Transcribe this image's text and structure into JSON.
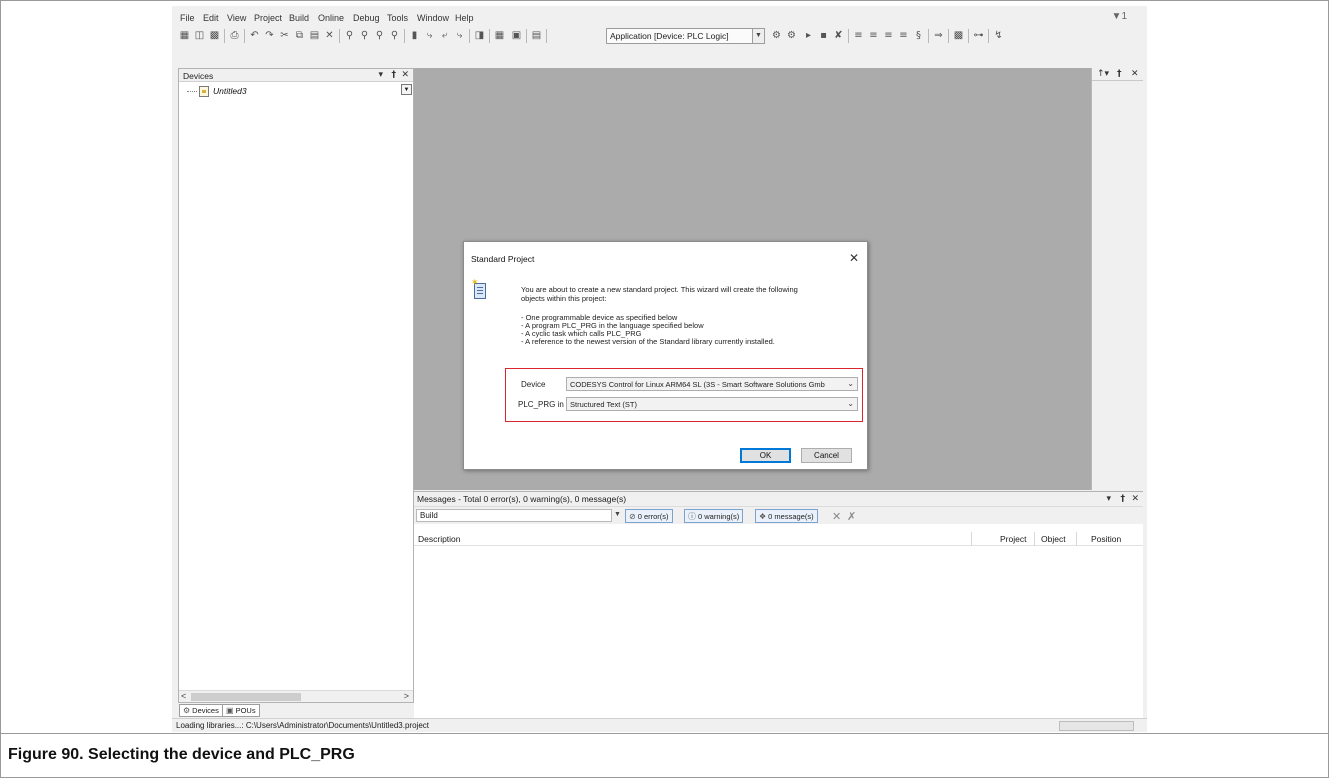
{
  "menu": [
    "File",
    "Edit",
    "View",
    "Project",
    "Build",
    "Online",
    "Debug",
    "Tools",
    "Window",
    "Help"
  ],
  "filter_indicator": "1",
  "toolbar": {
    "application_combo": "Application [Device: PLC Logic]"
  },
  "devices_panel": {
    "title": "Devices",
    "tree_item": "Untitled3",
    "tabs": [
      "Devices",
      "POUs"
    ]
  },
  "dialog": {
    "title": "Standard Project",
    "intro_line1": "You are about to create a new standard project. This wizard will create the following",
    "intro_line2": "objects within this project:",
    "bullets": [
      "- One programmable device as specified below",
      "- A program PLC_PRG in the language specified below",
      "- A cyclic task which calls PLC_PRG",
      "- A reference to the newest version of the Standard library currently installed."
    ],
    "device_label": "Device",
    "device_value": "CODESYS Control for Linux ARM64 SL (3S - Smart Software Solutions Gmb",
    "plcprg_label": "PLC_PRG in",
    "plcprg_value": "Structured Text (ST)",
    "ok_label": "OK",
    "cancel_label": "Cancel"
  },
  "messages": {
    "title": "Messages - Total 0 error(s), 0 warning(s), 0 message(s)",
    "source": "Build",
    "errors": "0 error(s)",
    "warnings": "0 warning(s)",
    "messages_count": "0 message(s)",
    "columns": [
      "Description",
      "Project",
      "Object",
      "Position"
    ]
  },
  "status": {
    "text": "Loading libraries...: C:\\Users\\Administrator\\Documents\\Untitled3.project"
  },
  "caption": "Figure 90.  Selecting the device and PLC_PRG",
  "colors": {
    "highlight_box": "#d9262e",
    "editor_bg": "#ababab",
    "default_button": "#0078d7"
  }
}
